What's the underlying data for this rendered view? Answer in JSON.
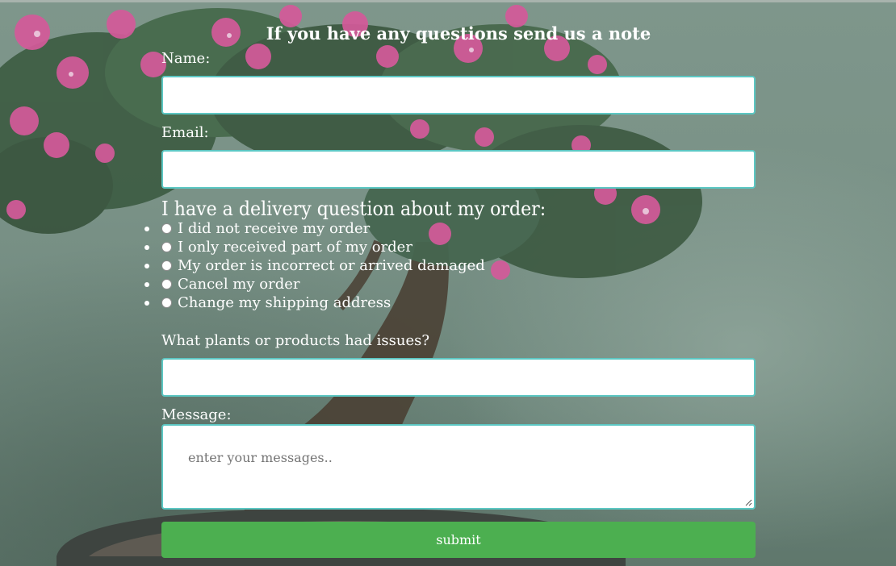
{
  "form": {
    "title": "If you have any questions send us a note",
    "name_label": "Name:",
    "name_value": "",
    "email_label": "Email:",
    "email_value": "",
    "delivery_legend": "I have a delivery question about my order:",
    "delivery_options": [
      {
        "label": "I did not receive my order",
        "checked": false
      },
      {
        "label": "I only received part of my order",
        "checked": false
      },
      {
        "label": "My order is incorrect or arrived damaged",
        "checked": false
      },
      {
        "label": "Cancel my order",
        "checked": false
      },
      {
        "label": "Change my shipping address",
        "checked": false
      }
    ],
    "products_label": "What plants or products had issues?",
    "products_value": "",
    "message_label": "Message:",
    "message_placeholder": "enter your messages..",
    "submit_label": "submit"
  },
  "colors": {
    "input_border": "#5cc7c3",
    "submit_bg": "#4caf50",
    "text": "#ffffff",
    "flower_pink": "#d45a9a"
  }
}
